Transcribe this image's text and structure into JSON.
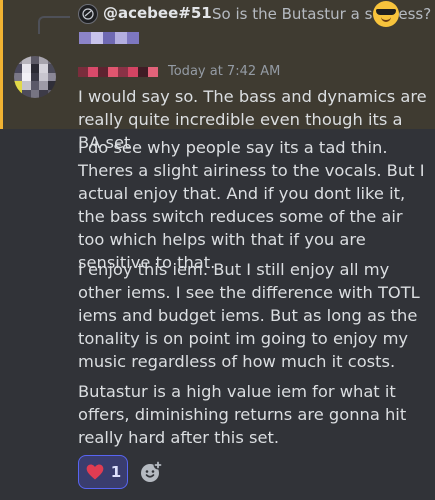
{
  "reply": {
    "author": "@acebee#51",
    "text": "So is the Butastur a success?",
    "emoji": "smiling-face-with-sunglasses"
  },
  "message": {
    "timestamp": "Today at 7:42 AM",
    "paragraphs": [
      "I would say so. The bass and dynamics are really quite incredible even though its a BA set",
      "I do see why people say its a tad thin. Theres a slight airiness to the vocals. But I actual enjoy that. And if you dont like it, the bass switch reduces some of the air too which helps with that if you are sensitive to that.",
      "I enjoy this iem. But I still enjoy all my other iems. I see the difference with TOTL iems and budget iems. But as long as the tonality is on point im going to enjoy my music regardless of how much it costs.",
      "Butastur is a high value iem for what it offers, diminishing returns are gonna hit really hard after this set."
    ]
  },
  "reactions": [
    {
      "emoji": "heart",
      "count": "1",
      "color": "#e03c52"
    }
  ],
  "colors": {
    "background": "#313338",
    "mention_highlight": "#3f3b31",
    "mention_bar": "#f0b232",
    "reaction_bg": "#3a3d6e",
    "reaction_border": "#5865f2"
  }
}
